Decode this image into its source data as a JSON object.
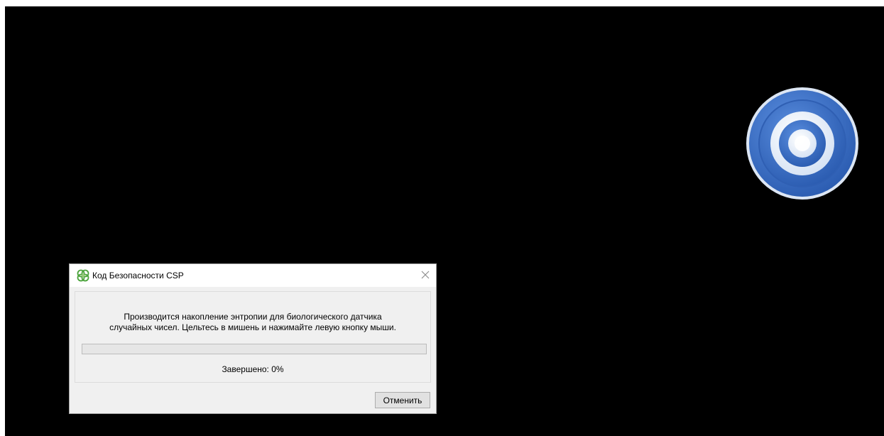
{
  "dialog": {
    "title": "Код Безопасности CSP",
    "app_icon": "csp-logo-icon",
    "close_icon": "close-icon",
    "message_line1": "Производится накопление энтропии для биологического датчика",
    "message_line2": "случайных чисел. Цельтесь в мишень и нажимайте левую кнопку мыши.",
    "progress_percent": 0,
    "status_text": "Завершено: 0%",
    "cancel_label": "Отменить"
  },
  "target": {
    "icon": "target-icon",
    "colors": {
      "outer": "#3a6fc4",
      "ring_light": "#ffffff",
      "center": "#2f66c0"
    }
  },
  "colors": {
    "screen_background": "#000000",
    "dialog_client": "#f0f0f0",
    "logo_green": "#4aa33a"
  }
}
